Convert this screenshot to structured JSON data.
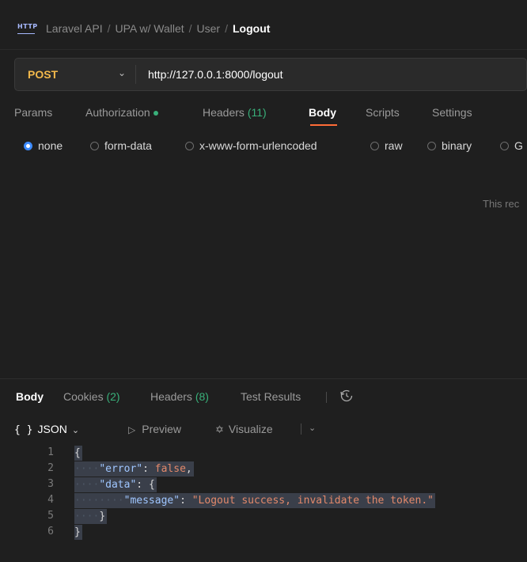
{
  "breadcrumb": {
    "icon_label": "HTTP",
    "items": [
      "Laravel API",
      "UPA w/ Wallet",
      "User"
    ],
    "current": "Logout"
  },
  "request": {
    "method": "POST",
    "url": "http://127.0.0.1:8000/logout"
  },
  "request_tabs": {
    "params": "Params",
    "authorization": "Authorization",
    "headers": "Headers",
    "headers_count": "(11)",
    "body": "Body",
    "scripts": "Scripts",
    "settings": "Settings"
  },
  "body_types": {
    "none": "none",
    "form_data": "form-data",
    "urlencoded": "x-www-form-urlencoded",
    "raw": "raw",
    "binary": "binary",
    "graphql": "G"
  },
  "empty_body_text": "This rec",
  "response_tabs": {
    "body": "Body",
    "cookies": "Cookies",
    "cookies_count": "(2)",
    "headers": "Headers",
    "headers_count": "(8)",
    "test_results": "Test Results"
  },
  "response_toolbar": {
    "format": "JSON",
    "preview": "Preview",
    "visualize": "Visualize"
  },
  "code_lines": {
    "n1": "1",
    "n2": "2",
    "n3": "3",
    "n4": "4",
    "n5": "5",
    "n6": "6",
    "l1_brace": "{",
    "l2_key": "\"error\"",
    "l2_val": "false",
    "l3_key": "\"data\"",
    "l3_brace": "{",
    "l4_key": "\"message\"",
    "l4_val": "\"Logout success, invalidate the token.\"",
    "l5_brace": "}",
    "l6_brace": "}"
  },
  "colors": {
    "method": "#f2b84b",
    "accent": "#ff6c37",
    "count_green": "#39b07a",
    "radio_selected": "#3d8bff",
    "json_key": "#9fc6ff",
    "json_value": "#e3896b"
  }
}
